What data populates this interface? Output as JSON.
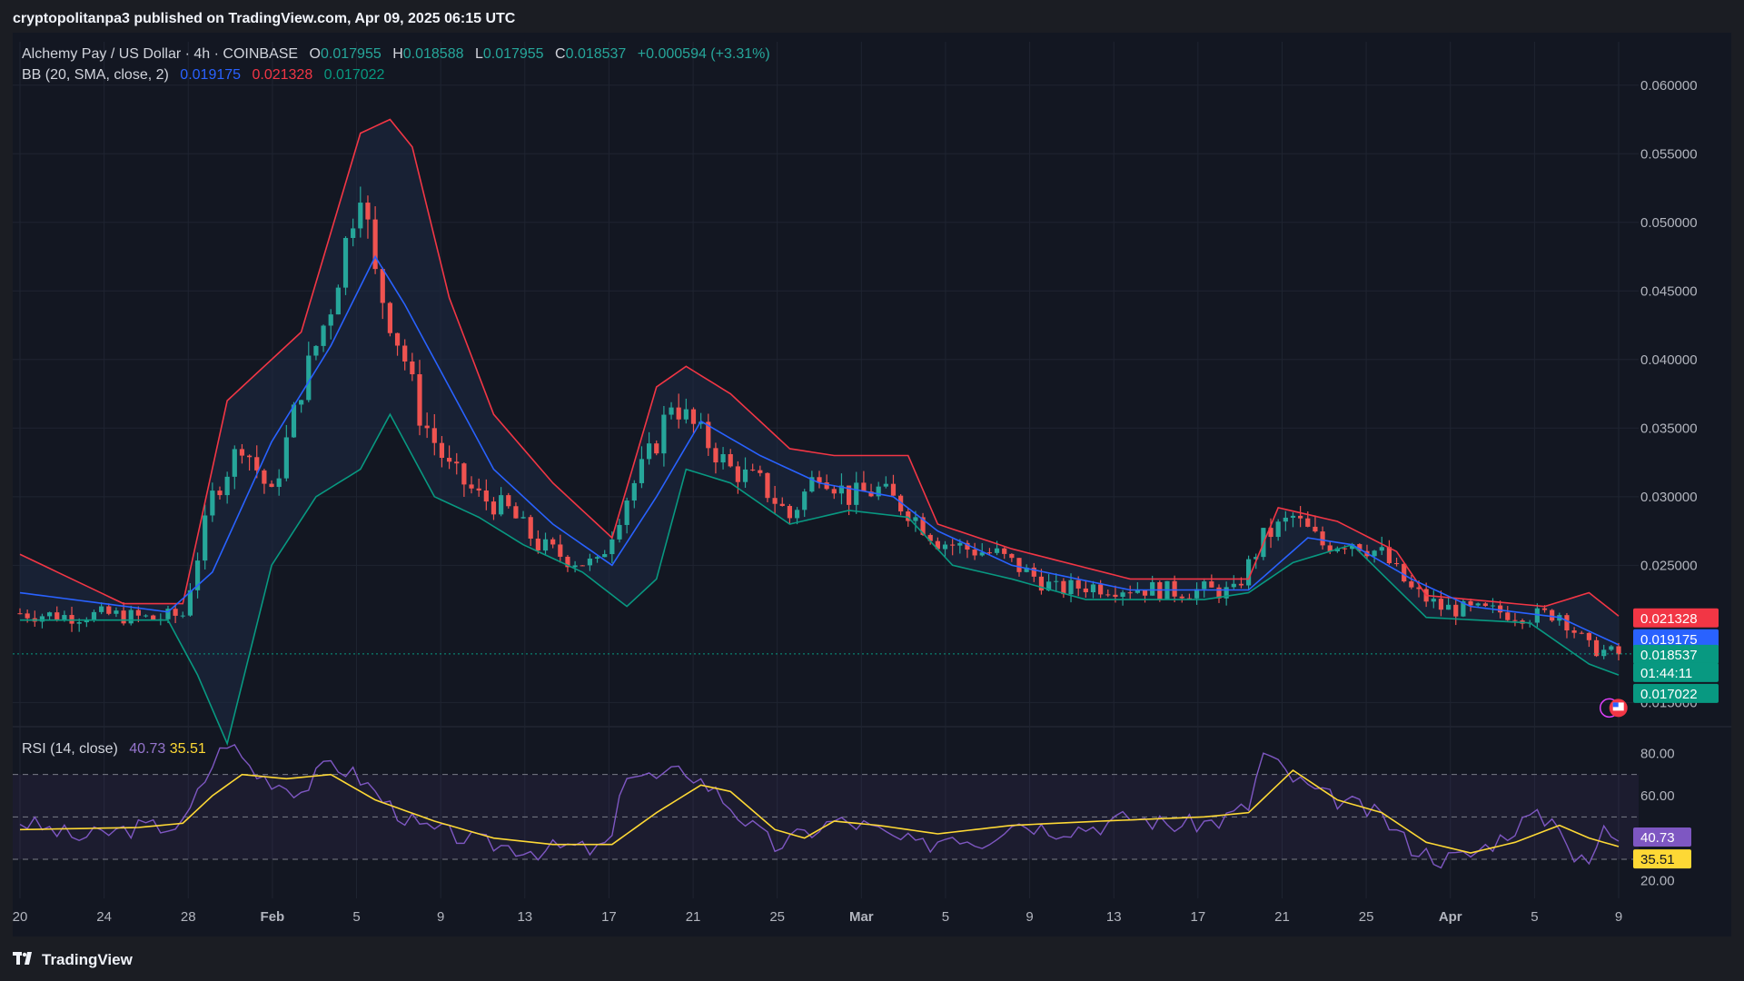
{
  "header": {
    "text": "cryptopolitanpa3 published on TradingView.com, Apr 09, 2025 06:15 UTC"
  },
  "legend": {
    "symbol": "Alchemy Pay / US Dollar · 4h · COINBASE",
    "o_label": "O",
    "o": "0.017955",
    "h_label": "H",
    "h": "0.018588",
    "l_label": "L",
    "l": "0.017955",
    "c_label": "C",
    "c": "0.018537",
    "change": "+0.000594 (+3.31%)",
    "bb_label": "BB (20, SMA, close, 2)",
    "bb_basis": "0.019175",
    "bb_upper": "0.021328",
    "bb_lower": "0.017022",
    "rsi_label": "RSI (14, close)",
    "rsi_value": "40.73",
    "rsi_ma": "35.51"
  },
  "footer": {
    "brand": "TradingView"
  },
  "colors": {
    "bg": "#131722",
    "grid": "#1f2431",
    "up": "#26a69a",
    "down": "#ef5350",
    "bb_upper": "#f23645",
    "bb_basis": "#2962ff",
    "bb_lower": "#089981",
    "bb_fill": "#1e2a44",
    "rsi": "#7e57c2",
    "rsi_ma": "#fdd835",
    "text": "#b2b5be"
  },
  "chart_data": [
    {
      "type": "candlestick",
      "title": "Alchemy Pay / US Dollar · 4h · COINBASE",
      "y_axis_ticks": [
        "0.060000",
        "0.055000",
        "0.050000",
        "0.045000",
        "0.040000",
        "0.035000",
        "0.030000",
        "0.025000",
        "0.015000"
      ],
      "ylim": [
        0.0135,
        0.0625
      ],
      "x_axis_ticks": [
        "20",
        "24",
        "28",
        "Feb",
        "5",
        "9",
        "13",
        "17",
        "21",
        "25",
        "Mar",
        "5",
        "9",
        "13",
        "17",
        "21",
        "25",
        "Apr",
        "5",
        "9"
      ],
      "price_labels": [
        {
          "value": "0.021328",
          "color": "#f23645"
        },
        {
          "value": "0.019175",
          "color": "#2962ff"
        },
        {
          "value": "0.018537",
          "color": "#089981"
        },
        {
          "value": "01:44:11",
          "color": "#089981"
        },
        {
          "value": "0.017022",
          "color": "#089981"
        }
      ],
      "close_anchors": [
        [
          0,
          0.0215
        ],
        [
          6,
          0.0213
        ],
        [
          12,
          0.0214
        ],
        [
          18,
          0.0211
        ],
        [
          22,
          0.0214
        ],
        [
          26,
          0.03
        ],
        [
          30,
          0.034
        ],
        [
          34,
          0.03
        ],
        [
          38,
          0.038
        ],
        [
          42,
          0.044
        ],
        [
          46,
          0.053
        ],
        [
          48,
          0.046
        ],
        [
          52,
          0.04
        ],
        [
          54,
          0.036
        ],
        [
          58,
          0.032
        ],
        [
          62,
          0.03
        ],
        [
          66,
          0.029
        ],
        [
          70,
          0.0265
        ],
        [
          74,
          0.0255
        ],
        [
          78,
          0.025
        ],
        [
          82,
          0.03
        ],
        [
          86,
          0.034
        ],
        [
          88,
          0.037
        ],
        [
          92,
          0.0345
        ],
        [
          96,
          0.032
        ],
        [
          100,
          0.031
        ],
        [
          104,
          0.0285
        ],
        [
          108,
          0.032
        ],
        [
          112,
          0.03
        ],
        [
          116,
          0.0305
        ],
        [
          120,
          0.029
        ],
        [
          124,
          0.0268
        ],
        [
          128,
          0.0262
        ],
        [
          132,
          0.0258
        ],
        [
          136,
          0.0245
        ],
        [
          140,
          0.0232
        ],
        [
          144,
          0.0235
        ],
        [
          148,
          0.0234
        ],
        [
          152,
          0.0233
        ],
        [
          156,
          0.0231
        ],
        [
          160,
          0.0232
        ],
        [
          164,
          0.023
        ],
        [
          168,
          0.027
        ],
        [
          172,
          0.0285
        ],
        [
          176,
          0.0265
        ],
        [
          180,
          0.0268
        ],
        [
          184,
          0.0258
        ],
        [
          188,
          0.0232
        ],
        [
          192,
          0.0219
        ],
        [
          196,
          0.0217
        ],
        [
          200,
          0.0216
        ],
        [
          204,
          0.0213
        ],
        [
          208,
          0.0215
        ],
        [
          212,
          0.019
        ],
        [
          216,
          0.0185
        ]
      ],
      "bollinger": {
        "upper_anchors": [
          [
            0,
            0.0258
          ],
          [
            14,
            0.0222
          ],
          [
            22,
            0.0222
          ],
          [
            28,
            0.037
          ],
          [
            38,
            0.042
          ],
          [
            46,
            0.0565
          ],
          [
            50,
            0.0575
          ],
          [
            53,
            0.0555
          ],
          [
            58,
            0.0445
          ],
          [
            64,
            0.036
          ],
          [
            72,
            0.031
          ],
          [
            80,
            0.027
          ],
          [
            86,
            0.038
          ],
          [
            90,
            0.0395
          ],
          [
            96,
            0.0375
          ],
          [
            104,
            0.0335
          ],
          [
            110,
            0.033
          ],
          [
            120,
            0.033
          ],
          [
            124,
            0.028
          ],
          [
            134,
            0.0262
          ],
          [
            150,
            0.024
          ],
          [
            166,
            0.024
          ],
          [
            170,
            0.0292
          ],
          [
            178,
            0.0282
          ],
          [
            186,
            0.026
          ],
          [
            190,
            0.0228
          ],
          [
            206,
            0.022
          ],
          [
            212,
            0.023
          ],
          [
            216,
            0.0213
          ]
        ],
        "basis_anchors": [
          [
            0,
            0.023
          ],
          [
            20,
            0.0216
          ],
          [
            26,
            0.0245
          ],
          [
            34,
            0.034
          ],
          [
            42,
            0.041
          ],
          [
            48,
            0.0475
          ],
          [
            52,
            0.044
          ],
          [
            58,
            0.038
          ],
          [
            64,
            0.032
          ],
          [
            72,
            0.028
          ],
          [
            80,
            0.025
          ],
          [
            86,
            0.03
          ],
          [
            92,
            0.0355
          ],
          [
            100,
            0.033
          ],
          [
            108,
            0.031
          ],
          [
            118,
            0.03
          ],
          [
            124,
            0.0275
          ],
          [
            134,
            0.025
          ],
          [
            150,
            0.0232
          ],
          [
            166,
            0.0232
          ],
          [
            174,
            0.027
          ],
          [
            180,
            0.0265
          ],
          [
            188,
            0.024
          ],
          [
            196,
            0.022
          ],
          [
            208,
            0.0212
          ],
          [
            216,
            0.0192
          ]
        ],
        "lower_anchors": [
          [
            0,
            0.021
          ],
          [
            20,
            0.021
          ],
          [
            24,
            0.017
          ],
          [
            28,
            0.012
          ],
          [
            34,
            0.025
          ],
          [
            40,
            0.03
          ],
          [
            46,
            0.032
          ],
          [
            50,
            0.036
          ],
          [
            56,
            0.03
          ],
          [
            62,
            0.0285
          ],
          [
            68,
            0.0265
          ],
          [
            76,
            0.0245
          ],
          [
            82,
            0.022
          ],
          [
            86,
            0.024
          ],
          [
            90,
            0.032
          ],
          [
            96,
            0.031
          ],
          [
            104,
            0.028
          ],
          [
            112,
            0.029
          ],
          [
            120,
            0.0285
          ],
          [
            126,
            0.025
          ],
          [
            134,
            0.024
          ],
          [
            144,
            0.0225
          ],
          [
            160,
            0.0225
          ],
          [
            166,
            0.023
          ],
          [
            172,
            0.0252
          ],
          [
            180,
            0.0265
          ],
          [
            190,
            0.0212
          ],
          [
            204,
            0.0208
          ],
          [
            212,
            0.0178
          ],
          [
            216,
            0.017
          ]
        ]
      }
    },
    {
      "type": "line",
      "title": "RSI (14, close)",
      "y_axis_ticks": [
        "80.00",
        "60.00",
        "20.00"
      ],
      "ylim": [
        15,
        90
      ],
      "bands": [
        70,
        50,
        30
      ],
      "series": [
        {
          "name": "RSI",
          "anchors": [
            [
              0,
              48
            ],
            [
              8,
              40
            ],
            [
              16,
              45
            ],
            [
              22,
              46
            ],
            [
              26,
              75
            ],
            [
              28,
              86
            ],
            [
              32,
              70
            ],
            [
              38,
              62
            ],
            [
              42,
              76
            ],
            [
              46,
              68
            ],
            [
              50,
              55
            ],
            [
              54,
              45
            ],
            [
              58,
              42
            ],
            [
              62,
              38
            ],
            [
              66,
              36
            ],
            [
              70,
              34
            ],
            [
              74,
              36
            ],
            [
              78,
              34
            ],
            [
              80,
              40
            ],
            [
              82,
              72
            ],
            [
              86,
              68
            ],
            [
              90,
              72
            ],
            [
              94,
              62
            ],
            [
              98,
              48
            ],
            [
              102,
              36
            ],
            [
              106,
              42
            ],
            [
              110,
              48
            ],
            [
              114,
              46
            ],
            [
              118,
              40
            ],
            [
              122,
              36
            ],
            [
              126,
              42
            ],
            [
              130,
              38
            ],
            [
              134,
              48
            ],
            [
              140,
              44
            ],
            [
              146,
              46
            ],
            [
              150,
              50
            ],
            [
              156,
              46
            ],
            [
              162,
              48
            ],
            [
              166,
              55
            ],
            [
              168,
              80
            ],
            [
              172,
              68
            ],
            [
              176,
              60
            ],
            [
              180,
              56
            ],
            [
              184,
              50
            ],
            [
              188,
              36
            ],
            [
              192,
              30
            ],
            [
              196,
              32
            ],
            [
              200,
              40
            ],
            [
              204,
              50
            ],
            [
              208,
              48
            ],
            [
              210,
              30
            ],
            [
              212,
              28
            ],
            [
              214,
              44
            ],
            [
              216,
              41
            ]
          ]
        },
        {
          "name": "RSI MA",
          "anchors": [
            [
              0,
              44
            ],
            [
              16,
              45
            ],
            [
              22,
              47
            ],
            [
              26,
              60
            ],
            [
              30,
              70
            ],
            [
              36,
              68
            ],
            [
              42,
              70
            ],
            [
              48,
              58
            ],
            [
              56,
              48
            ],
            [
              64,
              40
            ],
            [
              72,
              37
            ],
            [
              80,
              37
            ],
            [
              86,
              52
            ],
            [
              92,
              65
            ],
            [
              96,
              62
            ],
            [
              102,
              44
            ],
            [
              106,
              40
            ],
            [
              110,
              48
            ],
            [
              116,
              46
            ],
            [
              124,
              42
            ],
            [
              134,
              46
            ],
            [
              146,
              48
            ],
            [
              160,
              50
            ],
            [
              166,
              52
            ],
            [
              172,
              72
            ],
            [
              178,
              58
            ],
            [
              184,
              52
            ],
            [
              190,
              38
            ],
            [
              196,
              33
            ],
            [
              202,
              38
            ],
            [
              208,
              46
            ],
            [
              212,
              40
            ],
            [
              216,
              36
            ]
          ]
        }
      ]
    }
  ]
}
